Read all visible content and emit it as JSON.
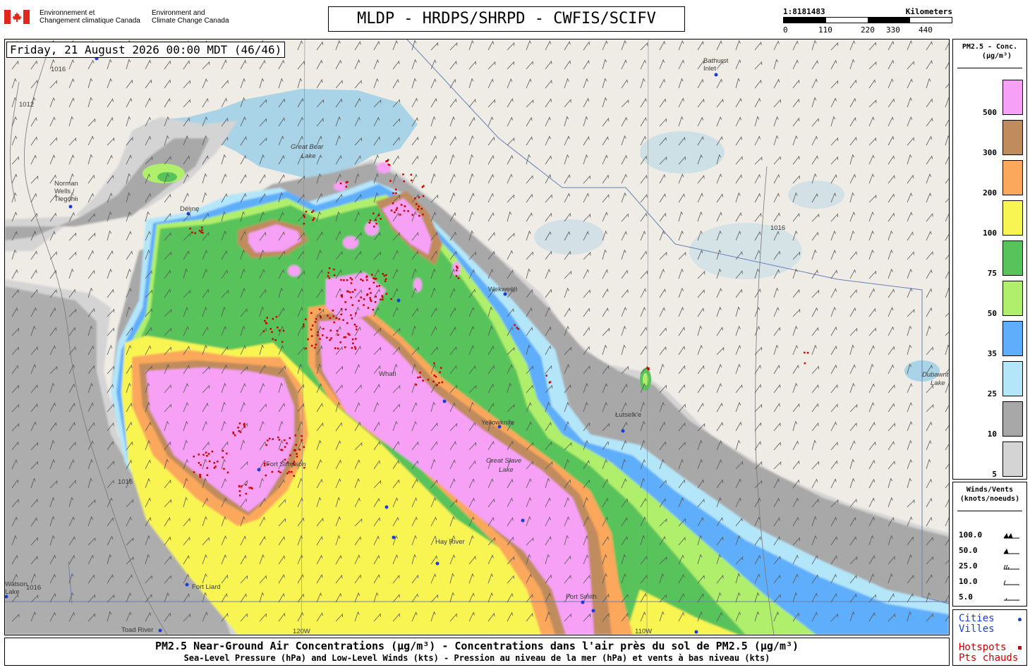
{
  "header": {
    "agency_fr_line1": "Environnement et",
    "agency_fr_line2": "Changement climatique Canada",
    "agency_en_line1": "Environment and",
    "agency_en_line2": "Climate Change Canada",
    "title": "MLDP - HRDPS/SHRPD - CWFIS/SCIFV",
    "scale_ratio": "1:8181483",
    "scale_units": "Kilometers",
    "scale_ticks": [
      "0",
      "110",
      "220",
      "330",
      "440"
    ]
  },
  "map": {
    "timestamp": "Friday, 21 August 2026 00:00 MDT (46/46)",
    "lakes": {
      "great_bear": "Great Bear\nLake",
      "great_slave": "Great Slave\nLake",
      "dubawnt": "Dubawnt\nLake"
    },
    "cities": [
      {
        "name": "Bathurst\nInlet"
      },
      {
        "name": "Norman\nWells /\nTłegóhłı"
      },
      {
        "name": "Délı̨nę"
      },
      {
        "name": "Wekweètì"
      },
      {
        "name": "Whatì"
      },
      {
        "name": "Yellowknife"
      },
      {
        "name": "Łutselk'e"
      },
      {
        "name": "Fort Simpson"
      },
      {
        "name": "Hay River"
      },
      {
        "name": "Fort Liard"
      },
      {
        "name": "Fort Smith"
      },
      {
        "name": "Toad River"
      },
      {
        "name": "Watson\nLake"
      }
    ],
    "isobar_labels": [
      "1016",
      "1012"
    ],
    "meridian_labels": [
      "120W",
      "110W"
    ]
  },
  "legend_pm": {
    "title_line1": "PM2.5 - Conc.",
    "title_line2": "(µg/m³)",
    "levels": [
      {
        "label": "500",
        "color": "#f6a1f5"
      },
      {
        "label": "300",
        "color": "#c08c5d"
      },
      {
        "label": "200",
        "color": "#fba75c"
      },
      {
        "label": "100",
        "color": "#f8f553"
      },
      {
        "label": "75",
        "color": "#58c35a"
      },
      {
        "label": "50",
        "color": "#b0ef6c"
      },
      {
        "label": "35",
        "color": "#5eaefc"
      },
      {
        "label": "25",
        "color": "#b4e6f9"
      },
      {
        "label": "10",
        "color": "#a8a8a8"
      },
      {
        "label": "5",
        "color": "#d4d4d4"
      }
    ]
  },
  "legend_wind": {
    "title_line1": "Winds/Vents",
    "title_line2": "(knots/noeuds)",
    "levels": [
      "100.0",
      "50.0",
      "25.0",
      "10.0",
      "5.0"
    ]
  },
  "legend_points": {
    "cities_en": "Cities",
    "cities_fr": "Villes",
    "hotspots_en": "Hotspots",
    "hotspots_fr": "Pts chauds",
    "city_color": "#1a3cd8",
    "hotspot_color": "#cc0000"
  },
  "footer": {
    "line1": "PM2.5 Near-Ground Air Concentrations (µg/m³) - Concentrations dans l'air près du sol de PM2.5 (µg/m³)",
    "line2": "Sea-Level Pressure (hPa) and Low-Level Winds (kts) - Pression au niveau de la mer (hPa) et vents à bas niveau (kts)"
  }
}
